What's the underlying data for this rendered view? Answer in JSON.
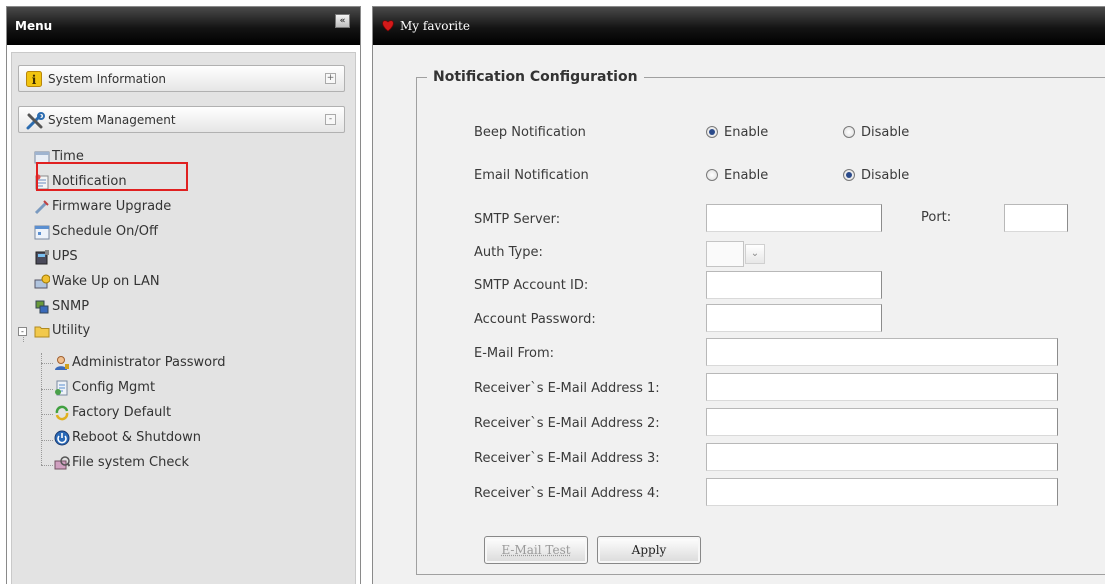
{
  "menu": {
    "title": "Menu",
    "collapse_glyph": "«",
    "groups": [
      {
        "label": "System Information",
        "icon": "info-icon",
        "toggle": "+"
      },
      {
        "label": "System Management",
        "icon": "tools-icon",
        "toggle": "-"
      }
    ],
    "items": [
      {
        "label": "Time",
        "icon": "clock-icon"
      },
      {
        "label": "Notification",
        "icon": "notification-icon"
      },
      {
        "label": "Firmware Upgrade",
        "icon": "firmware-icon"
      },
      {
        "label": "Schedule On/Off",
        "icon": "schedule-icon"
      },
      {
        "label": "UPS",
        "icon": "ups-icon"
      },
      {
        "label": "Wake Up on LAN",
        "icon": "wake-lan-icon"
      },
      {
        "label": "SNMP",
        "icon": "snmp-icon"
      },
      {
        "label": "Utility",
        "icon": "folder-icon",
        "expander": "-"
      },
      {
        "label": "Administrator Password",
        "icon": "admin-icon"
      },
      {
        "label": "Config Mgmt",
        "icon": "config-icon"
      },
      {
        "label": "Factory Default",
        "icon": "factory-default-icon"
      },
      {
        "label": "Reboot & Shutdown",
        "icon": "power-icon"
      },
      {
        "label": "File system Check",
        "icon": "filesystem-icon"
      }
    ],
    "selected_item": "Notification"
  },
  "favorite": {
    "title": "My favorite",
    "icon": "heart-icon"
  },
  "form": {
    "legend": "Notification Configuration",
    "beep": {
      "label": "Beep Notification",
      "enable_label": "Enable",
      "disable_label": "Disable",
      "selected": "Enable"
    },
    "email": {
      "label": "Email Notification",
      "enable_label": "Enable",
      "disable_label": "Disable",
      "selected": "Disable"
    },
    "smtp_server": {
      "label": "SMTP Server:",
      "value": ""
    },
    "port": {
      "label": "Port:",
      "value": ""
    },
    "auth_type": {
      "label": "Auth Type:",
      "value": ""
    },
    "smtp_account": {
      "label": "SMTP Account ID:",
      "value": ""
    },
    "account_password": {
      "label": "Account Password:",
      "value": ""
    },
    "mail_from": {
      "label": "E-Mail From:",
      "value": ""
    },
    "receivers": [
      {
        "label": "Receiver`s E-Mail Address 1:",
        "value": ""
      },
      {
        "label": "Receiver`s E-Mail Address 2:",
        "value": ""
      },
      {
        "label": "Receiver`s E-Mail Address 3:",
        "value": ""
      },
      {
        "label": "Receiver`s E-Mail Address 4:",
        "value": ""
      }
    ],
    "buttons": {
      "mail_test": "E-Mail Test",
      "apply": "Apply"
    }
  },
  "colors": {
    "header_bg": "#000000",
    "selection_border": "#e02020",
    "panel_bg": "#f1f1f1",
    "menu_bg": "#e3e3e3"
  }
}
